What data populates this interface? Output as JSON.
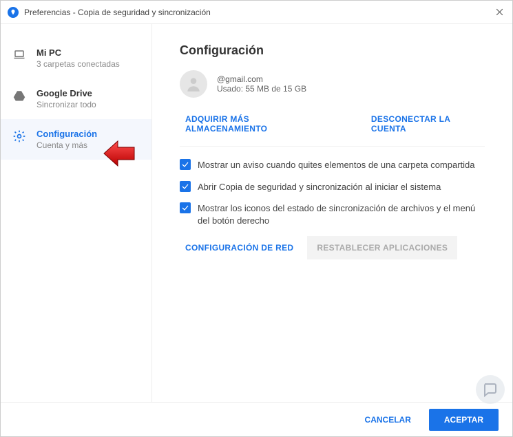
{
  "window": {
    "title": "Preferencias - Copia de seguridad y sincronización"
  },
  "sidebar": {
    "items": [
      {
        "title": "Mi PC",
        "subtitle": "3 carpetas conectadas"
      },
      {
        "title": "Google Drive",
        "subtitle": "Sincronizar todo"
      },
      {
        "title": "Configuración",
        "subtitle": "Cuenta y más"
      }
    ]
  },
  "main": {
    "heading": "Configuración",
    "account": {
      "email": "@gmail.com",
      "storage": "Usado: 55 MB de 15 GB"
    },
    "links": {
      "buy_storage": "ADQUIRIR MÁS ALMACENAMIENTO",
      "disconnect": "DESCONECTAR LA CUENTA"
    },
    "checkboxes": [
      "Mostrar un aviso cuando quites elementos de una carpeta compartida",
      "Abrir Copia de seguridad y sincronización al iniciar el sistema",
      "Mostrar los iconos del estado de sincronización de archivos y el menú del botón derecho"
    ],
    "buttons": {
      "network": "CONFIGURACIÓN DE RED",
      "reset_apps": "RESTABLECER APLICACIONES"
    }
  },
  "footer": {
    "cancel": "CANCELAR",
    "ok": "ACEPTAR"
  }
}
